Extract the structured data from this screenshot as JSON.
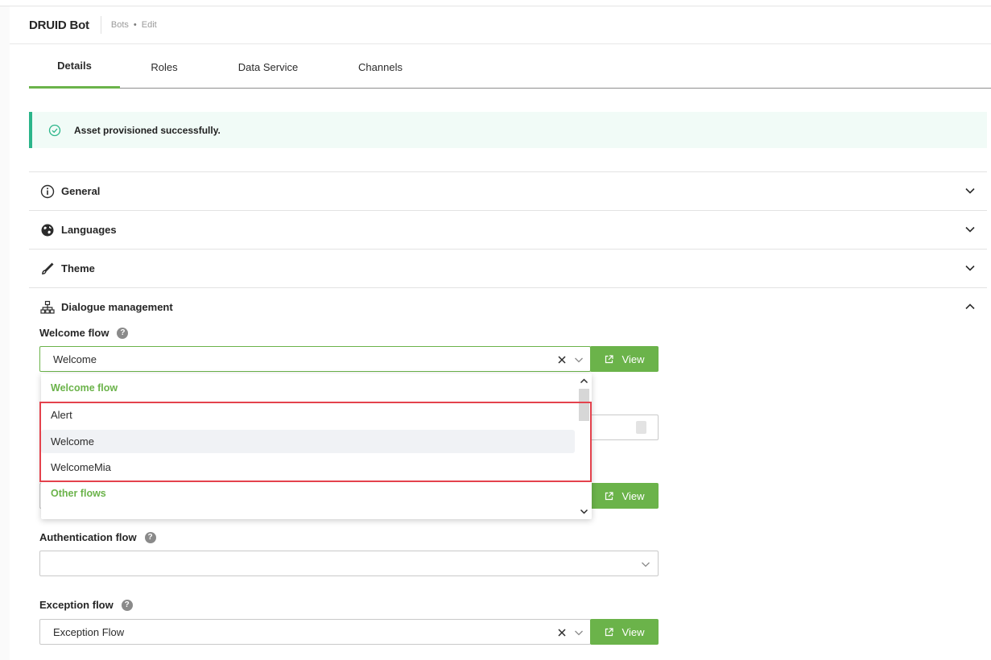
{
  "header": {
    "title": "DRUID Bot",
    "breadcrumb": [
      "Bots",
      "Edit"
    ],
    "breadcrumb_separator": "•"
  },
  "tabs": [
    {
      "label": "Details",
      "active": true
    },
    {
      "label": "Roles",
      "active": false
    },
    {
      "label": "Data Service",
      "active": false
    },
    {
      "label": "Channels",
      "active": false
    }
  ],
  "alert": {
    "message": "Asset provisioned successfully.",
    "icon": "check-circle-icon",
    "color": "#2bb58a"
  },
  "sections": [
    {
      "label": "General",
      "icon": "info-icon",
      "expanded": false
    },
    {
      "label": "Languages",
      "icon": "globe-icon",
      "expanded": false
    },
    {
      "label": "Theme",
      "icon": "brush-icon",
      "expanded": false
    },
    {
      "label": "Dialogue management",
      "icon": "sitemap-icon",
      "expanded": true
    }
  ],
  "dialogue": {
    "welcome_flow": {
      "label": "Welcome flow",
      "value": "Welcome",
      "view_label": "View"
    },
    "second_flow": {
      "view_label": "View"
    },
    "authentication_flow": {
      "label": "Authentication flow",
      "value": ""
    },
    "exception_flow": {
      "label": "Exception flow",
      "value": "Exception Flow",
      "view_label": "View"
    },
    "help_glyph": "?"
  },
  "dropdown": {
    "group_welcome": "Welcome flow",
    "options": [
      "Alert",
      "Welcome",
      "WelcomeMia"
    ],
    "hovered_option": "Welcome",
    "group_other": "Other flows"
  },
  "colors": {
    "accent": "#6bb34a",
    "highlight": "#e4424d"
  }
}
